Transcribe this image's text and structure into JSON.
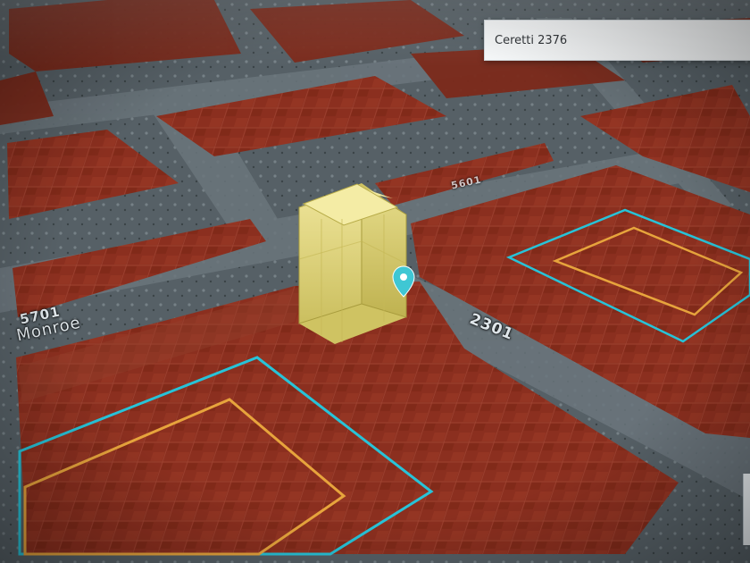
{
  "search": {
    "value": "Ceretti 2376"
  },
  "road_labels": {
    "street_2301": "2301",
    "street_5701": "5701",
    "street_monroe": "Monroe",
    "street_5601": "5601"
  },
  "icons": {
    "location_pin": "location-pin-icon"
  },
  "colors": {
    "parcel_fill": "#8b2f1f",
    "building_fill": "#e8df86",
    "boundary_cyan": "#27c3d8",
    "boundary_orange": "#e7a43c",
    "pin": "#3fc7d4"
  }
}
